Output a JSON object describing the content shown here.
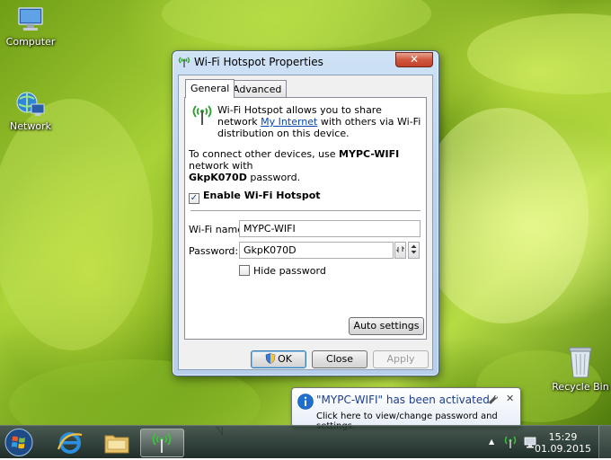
{
  "desktop": {
    "icons": [
      {
        "label": "Computer",
        "icon": "computer-icon"
      },
      {
        "label": "Network",
        "icon": "network-icon"
      },
      {
        "label": "Recycle Bin",
        "icon": "recycle-bin-icon"
      }
    ]
  },
  "dialog": {
    "title": "Wi-Fi Hotspot Properties",
    "close_glyph": "✕",
    "tabs": [
      {
        "label": "General",
        "selected": true
      },
      {
        "label": "Advanced",
        "selected": false
      }
    ],
    "intro_pre": "Wi-Fi Hotspot allows you to share network ",
    "intro_link": "My Internet",
    "intro_post": " with others via Wi-Fi distribution on this device.",
    "connect_pre": "To connect other devices, use ",
    "network_name_bold": "MYPC-WIFI",
    "connect_mid": " network with",
    "password_bold": "GkpK070D",
    "connect_post": " password.",
    "enable_hotspot": {
      "label": "Enable Wi-Fi Hotspot",
      "checked": true,
      "mark": "✓"
    },
    "wifi_name": {
      "label": "Wi-Fi name:",
      "value": "MYPC-WIFI"
    },
    "password": {
      "label": "Password:",
      "value": "GkpK070D"
    },
    "hide_password": {
      "label": "Hide password",
      "checked": false
    },
    "auto_settings_label": "Auto settings",
    "ok_label": "OK",
    "cancel_label": "Close",
    "apply_label": "Apply"
  },
  "balloon": {
    "title": "\"MYPC-WIFI\" has been activated",
    "body": "Click here to view/change password and settings.",
    "close_glyph": "✕"
  },
  "taskbar": {
    "clock_time": "15:29",
    "clock_date": "01.09.2015",
    "tray_up_arrow": "▲"
  },
  "colors": {
    "accent_link": "#0645ad",
    "title_close": "#c2412a",
    "hotspot_green": "#2aa02a"
  }
}
